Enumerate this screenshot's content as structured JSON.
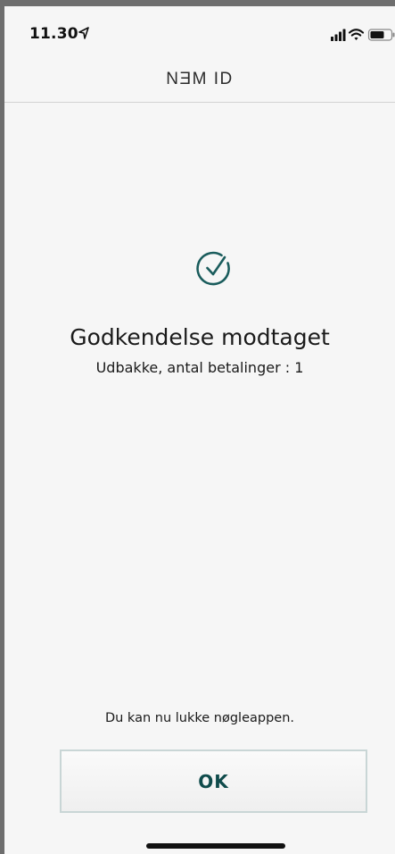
{
  "status_bar": {
    "time": "11.30",
    "location_icon": "location-arrow-icon",
    "signal_icon": "cellular-signal-icon",
    "wifi_icon": "wifi-icon",
    "battery_icon": "battery-icon"
  },
  "nav": {
    "title": "NƎM ID"
  },
  "main": {
    "status_icon": "check-circle-icon",
    "heading": "Godkendelse modtaget",
    "subheading": "Udbakke, antal betalinger : 1"
  },
  "footer": {
    "hint": "Du kan nu lukke nøgleappen.",
    "ok_label": "OK"
  },
  "colors": {
    "accent": "#1a5c5c",
    "button_text": "#0f4b4b",
    "background": "#f6f6f6"
  }
}
